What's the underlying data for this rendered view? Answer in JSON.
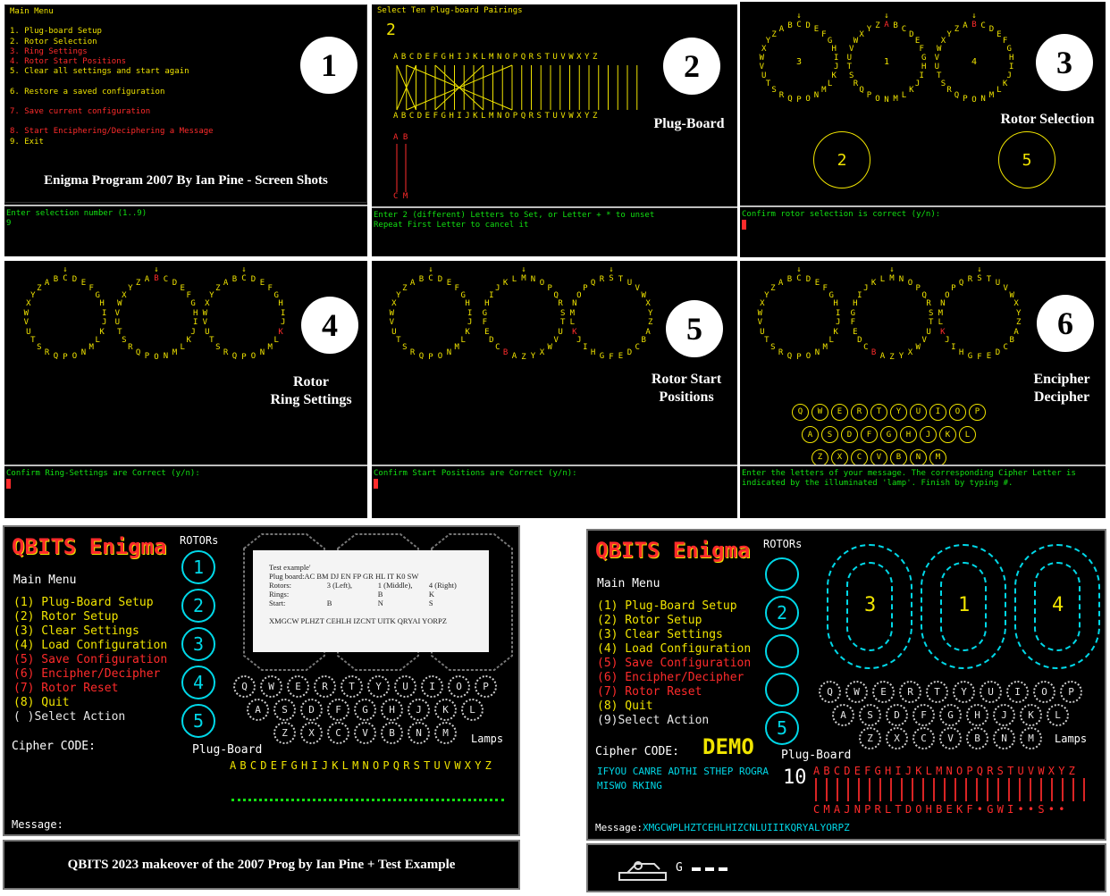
{
  "panels": {
    "p1": {
      "menu_title": "Main Menu",
      "menu_items": [
        {
          "text": "1. Plug-board Setup",
          "color": "#f0e400"
        },
        {
          "text": "2. Rotor Selection",
          "color": "#f0e400"
        },
        {
          "text": "3. Ring Settings",
          "color": "#ff2b2b"
        },
        {
          "text": "4. Rotor Start Positions",
          "color": "#ff2b2b"
        },
        {
          "text": "5. Clear all settings and start again",
          "color": "#f0e400"
        },
        {
          "text": "",
          "color": "#f0e400"
        },
        {
          "text": "6. Restore a saved configuration",
          "color": "#f0e400"
        },
        {
          "text": "",
          "color": "#f0e400"
        },
        {
          "text": "7. Save current configuration",
          "color": "#ff2b2b"
        },
        {
          "text": "",
          "color": "#f0e400"
        },
        {
          "text": "8. Start Enciphering/Deciphering a Message",
          "color": "#ff2b2b"
        },
        {
          "text": "9. Exit",
          "color": "#f0e400"
        }
      ],
      "caption": "Enigma Program 2007 By Ian Pine  - Screen Shots",
      "prompt": "Enter selection number (1..9)",
      "prompt_cursor": "9",
      "badge": "1"
    },
    "p2": {
      "title": "Select Ten Plug-board Pairings",
      "count": "2",
      "alphabet_top": "ABCDEFGHIJKLMNOPQRSTUVWXYZ",
      "alphabet_bottom": "ABCDEFGHIJKLMNOPQRSTUVWXYZ",
      "pair_top": "A B",
      "pair_bottom": "C M",
      "label": "Plug-Board",
      "prompt_line1": "Enter 2 (different) Letters to Set, or Letter + * to unset",
      "prompt_line2": "Repeat First Letter to cancel it",
      "badge": "2"
    },
    "p3": {
      "rotor_numbers": [
        "3",
        "1",
        "4"
      ],
      "selected": [
        "2",
        "5"
      ],
      "label": "Rotor Selection",
      "prompt": "Confirm rotor selection is correct (y/n):",
      "badge": "3"
    },
    "p4": {
      "label_line1": "Rotor",
      "label_line2": "Ring Settings",
      "prompt": "Confirm Ring-Settings are Correct (y/n):",
      "badge": "4"
    },
    "p5": {
      "label_line1": "Rotor Start",
      "label_line2": "Positions",
      "prompt": "Confirm Start Positions are Correct (y/n):",
      "badge": "5"
    },
    "p6": {
      "label_line1": "Encipher",
      "label_line2": "Decipher",
      "lamp_rows": [
        [
          "Q",
          "W",
          "E",
          "R",
          "T",
          "Y",
          "U",
          "I",
          "O",
          "P"
        ],
        [
          "A",
          "S",
          "D",
          "F",
          "G",
          "H",
          "J",
          "K",
          "L"
        ],
        [
          "Z",
          "X",
          "C",
          "V",
          "B",
          "N",
          "M"
        ]
      ],
      "prompt_line1": "Enter the letters of your message. The corresponding Cipher Letter is",
      "prompt_line2": "indicated by the illuminated 'lamp'. Finish by typing #.",
      "badge": "6"
    }
  },
  "ring_alphabet": "ABCDEFGHIJKLMNOPQRSTUVWXYZ",
  "qbits_left": {
    "logo": "QBITS Enigma",
    "rotors_label": "ROTORs",
    "rotor_buttons": [
      "1",
      "2",
      "3",
      "4",
      "5"
    ],
    "menu_title": "Main Menu",
    "menu_items": [
      {
        "text": "(1) Plug-Board Setup",
        "color": "#f0e400"
      },
      {
        "text": "(2) Rotor Setup",
        "color": "#f0e400"
      },
      {
        "text": "(3) Clear Settings",
        "color": "#f0e400"
      },
      {
        "text": "(4) Load Configuration",
        "color": "#f0e400"
      },
      {
        "text": "(5) Save Configuration",
        "color": "#ff2b2b"
      },
      {
        "text": "(6) Encipher/Decipher",
        "color": "#ff2b2b"
      },
      {
        "text": "(7) Rotor Reset",
        "color": "#ff2b2b"
      },
      {
        "text": "(8) Quit",
        "color": "#f0e400"
      },
      {
        "text": "( )Select Action",
        "color": "#e6e6e6"
      }
    ],
    "cipher_label": "Cipher CODE:",
    "plugboard_label": "Plug-Board",
    "lamps_label": "Lamps",
    "plug_alphabet": "ABCDEFGHIJKLMNOPQRSTUVWXYZ",
    "message_label": "Message:",
    "keyboard_rows": [
      [
        "Q",
        "W",
        "E",
        "R",
        "T",
        "Y",
        "U",
        "I",
        "O",
        "P"
      ],
      [
        "A",
        "S",
        "D",
        "F",
        "G",
        "H",
        "J",
        "K",
        "L"
      ],
      [
        "Z",
        "X",
        "C",
        "V",
        "B",
        "N",
        "M"
      ]
    ],
    "test_box": {
      "title": "Test example'",
      "rows": [
        {
          "label": "Plug board:",
          "c1": "AC BM DJ EN FP GR HL IT K0 SW",
          "c2": "",
          "c3": ""
        },
        {
          "label": "Rotors:",
          "c1": "3 (Left),",
          "c2": "1 (Middle),",
          "c3": "4 (Right)"
        },
        {
          "label": "Rings:",
          "c1": "",
          "c2": "B",
          "c3": "K"
        },
        {
          "label": "Start:",
          "c1": "B",
          "c2": "N",
          "c3": "S"
        }
      ],
      "cipher": "XMGCW PLHZT CEHLH IZCNT UITK QRYAI YORPZ"
    },
    "caption": "QBITS 2023 makeover of the 2007 Prog by Ian Pine + Test Example"
  },
  "qbits_right": {
    "logo": "QBITS Enigma",
    "rotors_label": "ROTORs",
    "rotor_buttons": [
      "",
      "2",
      "",
      "",
      "5"
    ],
    "rotor_window_letters": [
      "3",
      "1",
      "4"
    ],
    "menu_title": "Main Menu",
    "menu_items": [
      {
        "text": "(1) Plug-Board Setup",
        "color": "#f0e400"
      },
      {
        "text": "(2) Rotor Setup",
        "color": "#f0e400"
      },
      {
        "text": "(3) Clear Settings",
        "color": "#f0e400"
      },
      {
        "text": "(4) Load Configuration",
        "color": "#f0e400"
      },
      {
        "text": "(5) Save Configuration",
        "color": "#ff2b2b"
      },
      {
        "text": "(6) Encipher/Decipher",
        "color": "#ff2b2b"
      },
      {
        "text": "(7) Rotor Reset",
        "color": "#ff2b2b"
      },
      {
        "text": "(8) Quit",
        "color": "#f0e400"
      },
      {
        "text": "(9)Select Action",
        "color": "#e6e6e6"
      }
    ],
    "cipher_label": "Cipher CODE:",
    "cipher_value": "DEMO",
    "plain_line1": "IFYOU CANRE ADTHI STHEP ROGRA",
    "plain_line2": "MISWO RKING",
    "plugboard_label": "Plug-Board",
    "plug_count": "10",
    "plug_alphabet": "ABCDEFGHIJKLMNOPQRSTUVWXYZ",
    "plug_mapping": "CMAJNPRLTDOHBEKF•GWI••S••",
    "lamps_label": "Lamps",
    "message_label": "Message:",
    "message_value": "XMGCWPLHZTCEHLHIZCNLUIIIKQRYALYORPZ",
    "keyboard_rows": [
      [
        "Q",
        "W",
        "E",
        "R",
        "T",
        "Y",
        "U",
        "I",
        "O",
        "P"
      ],
      [
        "A",
        "S",
        "D",
        "F",
        "G",
        "H",
        "J",
        "K",
        "L"
      ],
      [
        "Z",
        "X",
        "C",
        "V",
        "B",
        "N",
        "M"
      ]
    ],
    "status_text": "G"
  }
}
